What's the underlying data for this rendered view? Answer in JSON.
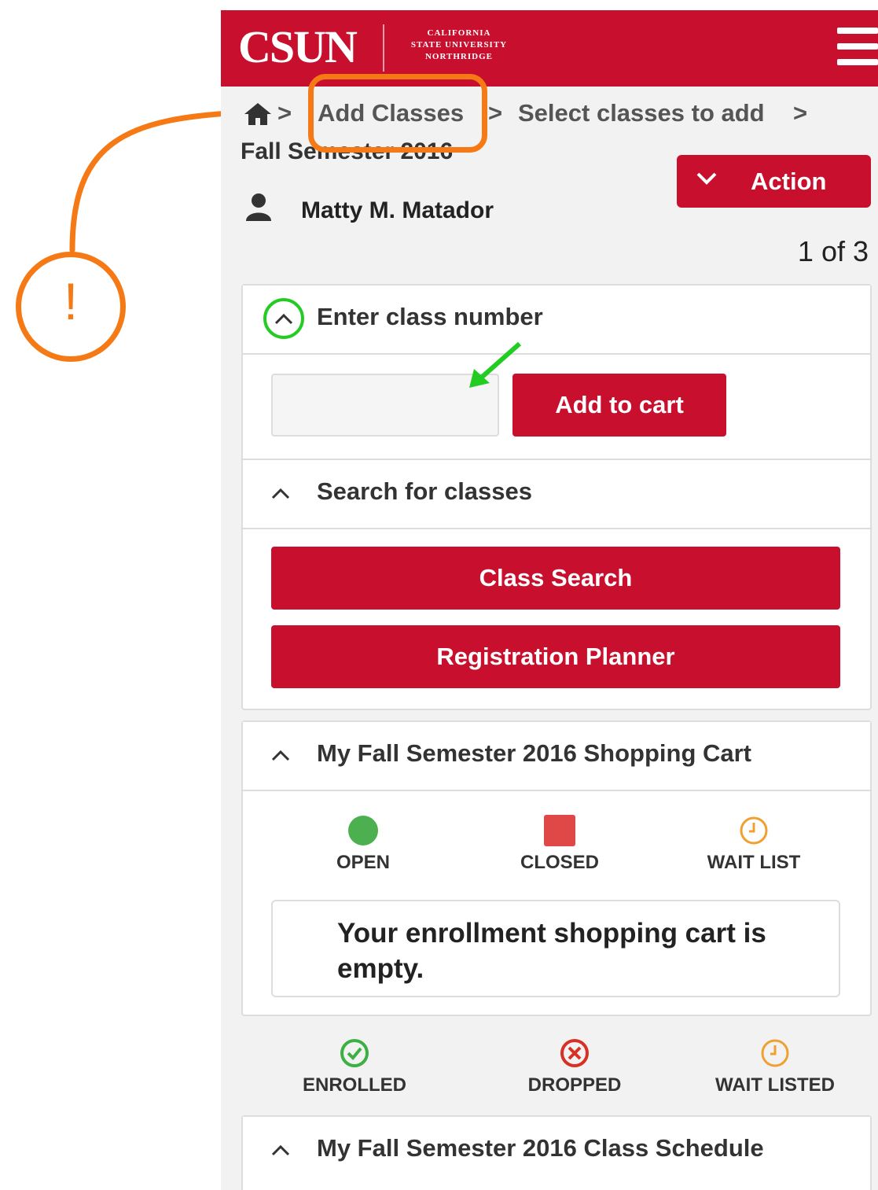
{
  "header": {
    "logo_main": "CSUN",
    "logo_line1": "CALIFORNIA",
    "logo_line2": "STATE UNIVERSITY",
    "logo_line3": "NORTHRIDGE",
    "brand_color": "#c8102e"
  },
  "breadcrumb": {
    "item1": "Add Classes",
    "separator1": ">",
    "item2": "Select classes to add",
    "separator2": ">",
    "term": "Fall Semester 2016"
  },
  "action": {
    "label": "Action"
  },
  "user": {
    "name": "Matty M. Matador"
  },
  "pager": {
    "text": "1 of 3"
  },
  "enter_class": {
    "title": "Enter class number",
    "input_value": "",
    "add_button": "Add to cart"
  },
  "search": {
    "title": "Search for classes",
    "class_search_button": "Class Search",
    "planner_button": "Registration Planner"
  },
  "cart": {
    "title": "My Fall Semester 2016 Shopping Cart",
    "legend": [
      {
        "label": "OPEN",
        "icon": "open-circle-icon",
        "color": "#4caf50"
      },
      {
        "label": "CLOSED",
        "icon": "closed-square-icon",
        "color": "#e04848"
      },
      {
        "label": "WAIT LIST",
        "icon": "clock-icon",
        "color": "#f0a030"
      }
    ],
    "empty_message": "Your enrollment shopping cart is empty."
  },
  "status_legend": [
    {
      "label": "ENROLLED",
      "icon": "check-circle-icon",
      "color": "#3cb043"
    },
    {
      "label": "DROPPED",
      "icon": "x-circle-icon",
      "color": "#d93025"
    },
    {
      "label": "WAIT LISTED",
      "icon": "clock-icon",
      "color": "#f0a030"
    }
  ],
  "schedule": {
    "title": "My Fall Semester 2016 Class Schedule"
  },
  "annotation": {
    "alert_mark": "!",
    "accent": "#f57a16",
    "highlight": "#22cc22"
  }
}
